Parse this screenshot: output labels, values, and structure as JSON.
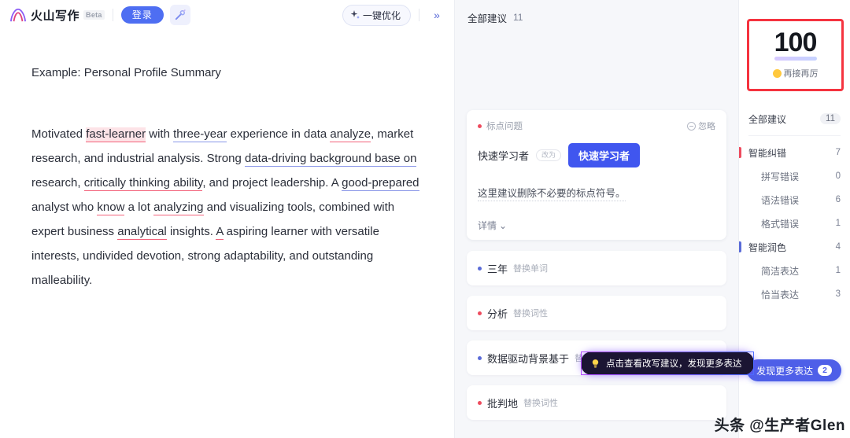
{
  "header": {
    "brand_name": "火山写作",
    "beta_label": "Beta",
    "login_label": "登录",
    "magic_icon": "magic-wand-icon",
    "optimize_label": "一键优化",
    "optimize_icon": "sparkle-icon",
    "expand_label": "»"
  },
  "editor": {
    "title": "Example: Personal Profile Summary",
    "paragraph": {
      "s1": "Motivated ",
      "m1": "fast-learner",
      "s2": " with ",
      "m2": "three-year",
      "s3": " experience in data ",
      "m3": "analyze",
      "s4": ", market research, and industrial analysis. Strong ",
      "m4": "data-driving background base on",
      "s5": " research, ",
      "m5": "critically thinking ability",
      "s6": ", and project leadership. A ",
      "m6": "good-prepared",
      "s7": " analyst who ",
      "m7": "know",
      "s8": " a lot ",
      "m8": "analyzing",
      "s9": " and visualizing tools, combined with expert business ",
      "m9": "analytical",
      "s10": " insights. ",
      "m10": "A",
      "s11": " aspiring learner with versatile interests, undivided devotion, strong adaptability, and outstanding malleability."
    }
  },
  "suggestions_panel": {
    "header_label": "全部建议",
    "header_count": "11",
    "card": {
      "type_label": "标点问题",
      "ignore_label": "忽略",
      "original": "快速学习者",
      "arrow_label": "改为",
      "replacement": "快速学习者",
      "description": "这里建议删除不必要的标点符号。",
      "more_label": "详情",
      "chevron": "⌄"
    },
    "items": [
      {
        "word": "三年",
        "tag": "替换单词",
        "dot": "blue"
      },
      {
        "word": "分析",
        "tag": "替换词性",
        "dot": "red"
      },
      {
        "word": "数据驱动背景基于",
        "tag": "替换短语",
        "dot": "blue"
      },
      {
        "word": "批判地",
        "tag": "替换词性",
        "dot": "red"
      }
    ]
  },
  "tooltip": {
    "icon": "lightbulb-icon",
    "text": "点击查看改写建议，发现更多表达"
  },
  "sidebar": {
    "score": "100",
    "score_sub": "再接再厉",
    "nav": [
      {
        "label": "全部建议",
        "count": "11",
        "level": "top",
        "bar": "none",
        "pill": true
      },
      {
        "label": "智能纠错",
        "count": "7",
        "level": "top",
        "bar": "red",
        "pill": false
      },
      {
        "label": "拼写错误",
        "count": "0",
        "level": "sub",
        "bar": "none",
        "pill": false
      },
      {
        "label": "语法错误",
        "count": "6",
        "level": "sub",
        "bar": "none",
        "pill": false
      },
      {
        "label": "格式错误",
        "count": "1",
        "level": "sub",
        "bar": "none",
        "pill": false
      },
      {
        "label": "智能润色",
        "count": "4",
        "level": "top",
        "bar": "blue",
        "pill": false
      },
      {
        "label": "简洁表达",
        "count": "1",
        "level": "sub",
        "bar": "none",
        "pill": false
      },
      {
        "label": "恰当表达",
        "count": "3",
        "level": "sub",
        "bar": "none",
        "pill": false
      }
    ],
    "discover_label": "发现更多表达",
    "discover_count": "2"
  },
  "watermark": "头条 @生产者Glen",
  "colors": {
    "accent_blue": "#4e6ef2",
    "error_red": "#ee4b5e",
    "polish_blue": "#5a6bd8",
    "annotation_red": "#f5333f"
  }
}
